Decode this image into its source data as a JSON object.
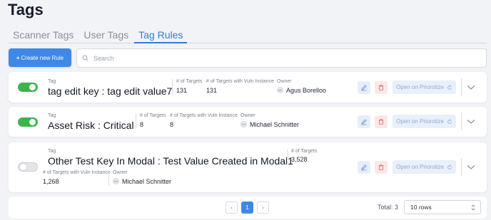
{
  "page": {
    "title": "Tags"
  },
  "tabs": [
    {
      "label": "Scanner Tags",
      "active": false
    },
    {
      "label": "User Tags",
      "active": false
    },
    {
      "label": "Tag Rules",
      "active": true
    }
  ],
  "toolbar": {
    "create_label": "Create new Rule",
    "create_icon": "plus-icon",
    "search_placeholder": "Search",
    "search_icon": "search-icon"
  },
  "labels": {
    "tag": "Tag",
    "targets": "# of Targets",
    "targets_vuln": "# of Targets with Vuln Instance",
    "owner": "Owner",
    "prioritize": "Open on Priorotize"
  },
  "rules": [
    {
      "enabled": true,
      "tag": "tag edit key : tag edit value7",
      "targets": "131",
      "targets_vuln": "131",
      "owner_initials": "AB",
      "owner": "Agus Borelloo"
    },
    {
      "enabled": true,
      "tag": "Asset Risk : Critical",
      "targets": "8",
      "targets_vuln": "8",
      "owner_initials": "MS",
      "owner": "Michael Schnitter"
    },
    {
      "enabled": false,
      "tag": "Other Test Key In Modal : Test Value Created in Modal1",
      "targets": "3,528",
      "targets_vuln": "1,268",
      "owner_initials": "MS",
      "owner": "Michael Schnitter"
    }
  ],
  "pagination": {
    "prev": "‹",
    "current": "1",
    "next": "›",
    "total_label": "Total: 3",
    "rows_option": "10 rows"
  },
  "colors": {
    "accent": "#3f88e6",
    "toggle_on": "#3bb54a",
    "delete": "#e06565"
  }
}
